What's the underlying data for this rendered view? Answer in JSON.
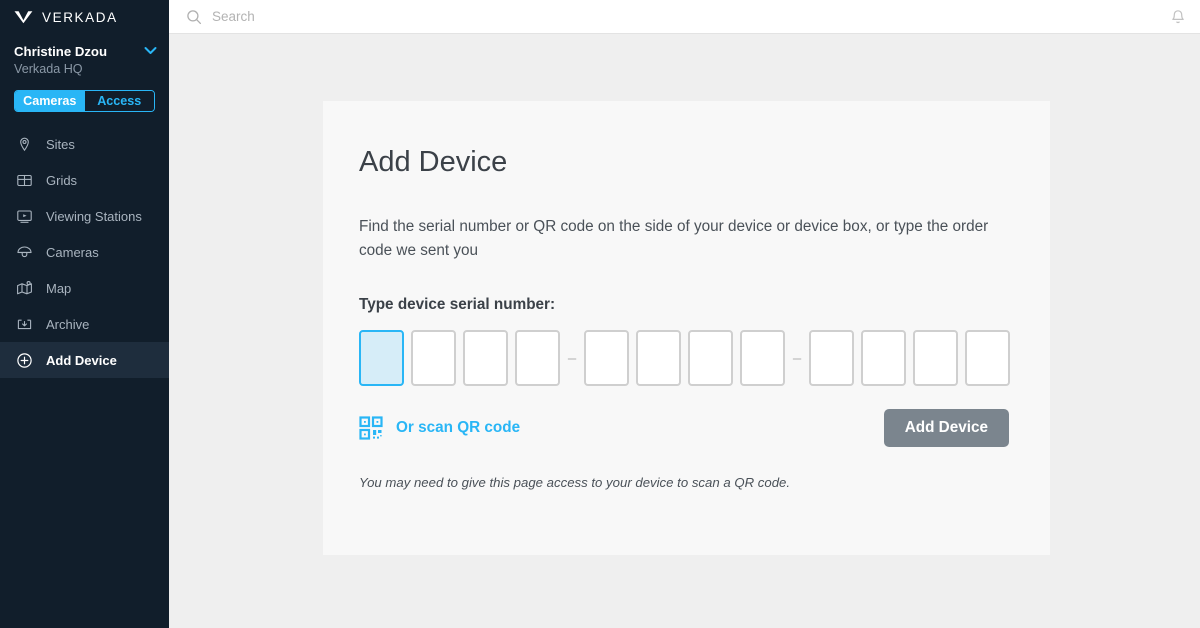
{
  "sidebar": {
    "brand": {
      "name": "VERKADA",
      "logo_icon": "verkada-check-logo"
    },
    "account": {
      "name": "Christine Dzou",
      "org": "Verkada HQ",
      "chevron_icon": "chevron-down-icon"
    },
    "toggle": {
      "active_label": "Cameras",
      "inactive_label": "Access",
      "active_color": "#29B6F6"
    },
    "items": [
      {
        "label": "Sites",
        "icon": "map-pin-icon",
        "active": false
      },
      {
        "label": "Grids",
        "icon": "grid-icon",
        "active": false
      },
      {
        "label": "Viewing Stations",
        "icon": "monitor-play-icon",
        "active": false
      },
      {
        "label": "Cameras",
        "icon": "dome-camera-icon",
        "active": false
      },
      {
        "label": "Map",
        "icon": "folded-map-icon",
        "active": false
      },
      {
        "label": "Archive",
        "icon": "archive-box-icon",
        "active": false
      },
      {
        "label": "Add Device",
        "icon": "plus-circle-icon",
        "active": true
      }
    ],
    "background_color": "#111E2B",
    "active_item_color": "#1E2D3D"
  },
  "topbar": {
    "search": {
      "placeholder": "Search",
      "value": "",
      "icon": "search-icon"
    },
    "notifications_icon": "bell-icon"
  },
  "main": {
    "title": "Add Device",
    "description": "Find the serial number or QR code on the side of your device or device box, or type the order code we sent you",
    "serial": {
      "label": "Type device serial number:",
      "groups": [
        {
          "cells": [
            "",
            "",
            "",
            ""
          ]
        },
        {
          "cells": [
            "",
            "",
            "",
            ""
          ]
        },
        {
          "cells": [
            "",
            "",
            "",
            ""
          ]
        }
      ],
      "separator": "–",
      "focused_group": 0,
      "focused_cell": 0,
      "focus_border_color": "#29B6F6",
      "focus_fill_color": "#D6EDF8"
    },
    "qr_link": {
      "label": "Or scan QR code",
      "icon": "qr-code-icon",
      "color": "#29B6F6"
    },
    "submit_button": {
      "label": "Add Device",
      "color": "#7B858E"
    },
    "note": "You may need to give this page access to your device to scan a QR code."
  }
}
